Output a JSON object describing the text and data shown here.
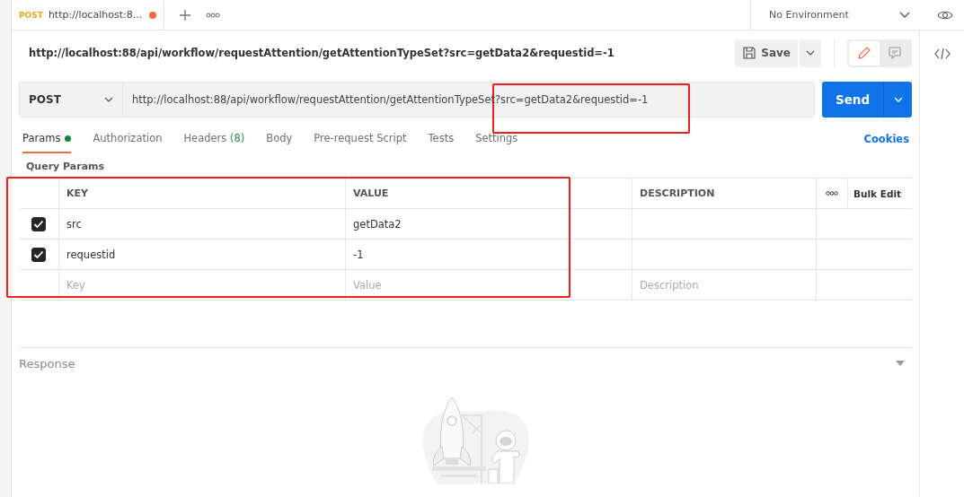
{
  "tab": {
    "method": "POST",
    "title": "http://localhost:8...",
    "unsaved": true
  },
  "environment": {
    "label": "No Environment"
  },
  "request_title": "http://localhost:88/api/workflow/requestAttention/getAttentionTypeSet?src=getData2&requestid=-1",
  "save_button": "Save",
  "view_modes": [
    {
      "kind": "edit",
      "selected": true
    },
    {
      "kind": "comments",
      "selected": false
    }
  ],
  "request": {
    "method": "POST",
    "url": "http://localhost:88/api/workflow/requestAttention/getAttentionTypeSet?src=getData2&requestid=-1",
    "send": "Send"
  },
  "tabs": [
    {
      "label": "Params",
      "selected": true,
      "indicator": true
    },
    {
      "label": "Authorization",
      "selected": false,
      "indicator": false
    },
    {
      "label": "Headers",
      "count": "(8)",
      "selected": false,
      "indicator": false
    },
    {
      "label": "Body",
      "selected": false,
      "indicator": false
    },
    {
      "label": "Pre-request Script",
      "selected": false,
      "indicator": false
    },
    {
      "label": "Tests",
      "selected": false,
      "indicator": false
    },
    {
      "label": "Settings",
      "selected": false,
      "indicator": false
    }
  ],
  "cookies": "Cookies",
  "section_title": "Query Params",
  "table": {
    "columns": [
      "KEY",
      "VALUE",
      "DESCRIPTION"
    ],
    "bulk_edit": "Bulk Edit",
    "rows": [
      {
        "key": "src",
        "value": "getData2",
        "checked": true
      },
      {
        "key": "requestid",
        "value": "-1",
        "checked": true
      }
    ],
    "new_row": {
      "key": {
        "placeholder": "Key"
      },
      "value": {
        "placeholder": "Value"
      },
      "description": {
        "placeholder": "Description"
      }
    }
  },
  "response": {
    "title": "Response"
  }
}
